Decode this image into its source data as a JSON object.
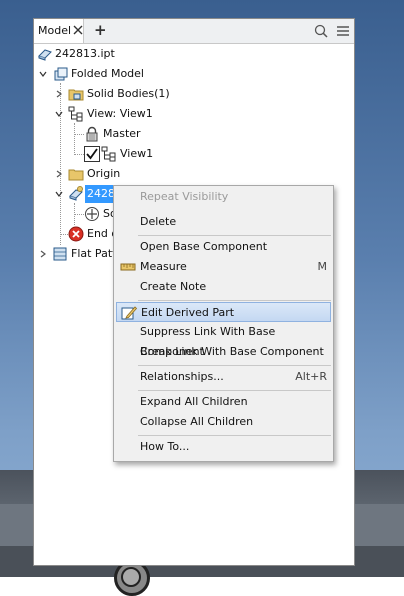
{
  "panel": {
    "tab_label": "Model",
    "add_label": "+"
  },
  "tree": {
    "file": "242813.ipt",
    "folded_model": "Folded Model",
    "solid_bodies": "Solid Bodies(1)",
    "view": "View: View1",
    "master": "Master",
    "view1": "View1",
    "origin": "Origin",
    "derived_part": "2428",
    "solid_partial": "So",
    "end_of_part": "End o",
    "flat_pattern": "Flat Patte"
  },
  "context_menu": {
    "items": [
      {
        "label": "Repeat Visibility",
        "shortcut": "",
        "disabled": true
      },
      {
        "label": "Delete",
        "shortcut": ""
      },
      {
        "label": "Open Base Component",
        "shortcut": ""
      },
      {
        "label": "Measure",
        "shortcut": "M"
      },
      {
        "label": "Create Note",
        "shortcut": ""
      },
      {
        "label": "Edit Derived Part",
        "shortcut": "",
        "highlighted": true
      },
      {
        "label": "Suppress Link With Base Component",
        "shortcut": ""
      },
      {
        "label": "Break Link With Base Component",
        "shortcut": ""
      },
      {
        "label": "Relationships...",
        "shortcut": "Alt+R"
      },
      {
        "label": "Expand All Children",
        "shortcut": ""
      },
      {
        "label": "Collapse All Children",
        "shortcut": ""
      },
      {
        "label": "How To...",
        "shortcut": ""
      }
    ]
  },
  "colors": {
    "selection": "#3399ff",
    "menu_highlight": "#c4d8f2",
    "error_icon": "#d93025",
    "folder": "#e8c66a"
  },
  "icons": [
    "close-icon",
    "add-icon",
    "search-icon",
    "hamburger-menu-icon",
    "part-file-icon",
    "folded-model-icon",
    "solid-bodies-icon",
    "view-rep-icon",
    "lock-icon",
    "checkbox-checked-icon",
    "folder-icon",
    "derived-part-icon",
    "solid-body-icon",
    "end-of-part-icon",
    "flat-pattern-icon",
    "measure-icon",
    "edit-derived-part-icon"
  ]
}
